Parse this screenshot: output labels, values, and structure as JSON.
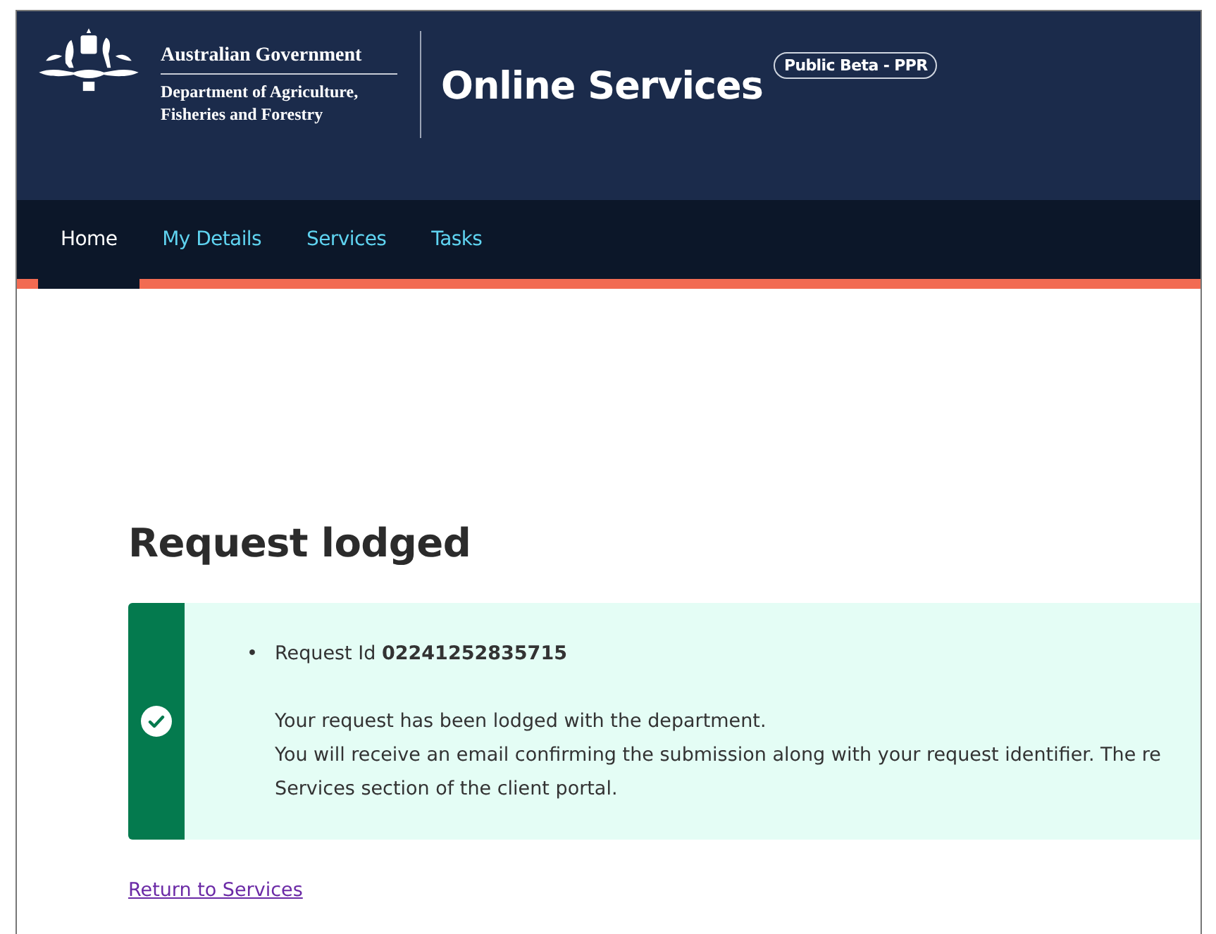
{
  "header": {
    "government": "Australian Government",
    "department_line_1": "Department of Agriculture,",
    "department_line_2": "Fisheries and Forestry",
    "site_title": "Online Services",
    "badge": "Public Beta - PPR"
  },
  "nav": [
    {
      "label": "Home",
      "selected": true
    },
    {
      "label": "My Details",
      "selected": false
    },
    {
      "label": "Services",
      "selected": false
    },
    {
      "label": "Tasks",
      "selected": false
    }
  ],
  "page_title": "Request lodged",
  "alert": {
    "kind": "success",
    "list": [
      {
        "marker": "•",
        "text": "Request Id **02241252835715**"
      }
    ],
    "lines": [
      "Your request has been lodged with the department.",
      "You will receive an email confirming the submission along with your request identifier. The re",
      "Services section of the client portal."
    ]
  },
  "return_link": "Return to Services"
}
